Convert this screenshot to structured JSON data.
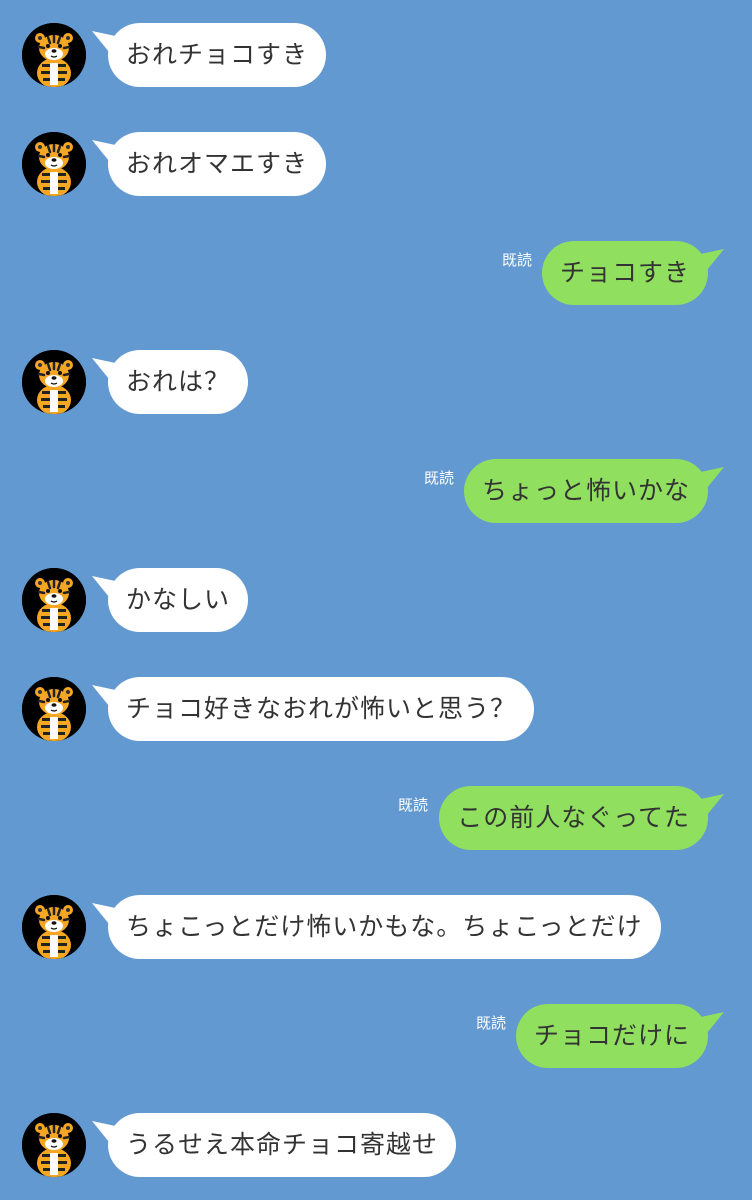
{
  "read_label": "既読",
  "messages": [
    {
      "side": "in",
      "text": "おれチョコすき"
    },
    {
      "side": "in",
      "text": "おれオマエすき"
    },
    {
      "side": "out",
      "text": "チョコすき",
      "read": true
    },
    {
      "side": "in",
      "text": "おれは？"
    },
    {
      "side": "out",
      "text": "ちょっと怖いかな",
      "read": true
    },
    {
      "side": "in",
      "text": "かなしい"
    },
    {
      "side": "in",
      "text": "チョコ好きなおれが怖いと思う？"
    },
    {
      "side": "out",
      "text": "この前人なぐってた",
      "read": true
    },
    {
      "side": "in",
      "text": "ちょこっとだけ怖いかもな。ちょこっとだけ"
    },
    {
      "side": "out",
      "text": "チョコだけに",
      "read": true
    },
    {
      "side": "in",
      "text": "うるせえ本命チョコ寄越せ"
    }
  ],
  "colors": {
    "background": "#6299d0",
    "incoming_bubble": "#ffffff",
    "outgoing_bubble": "#90df5f",
    "text": "#333333",
    "read_text": "#ffffff"
  },
  "icons": {
    "avatar": "tiger-avatar-icon"
  }
}
